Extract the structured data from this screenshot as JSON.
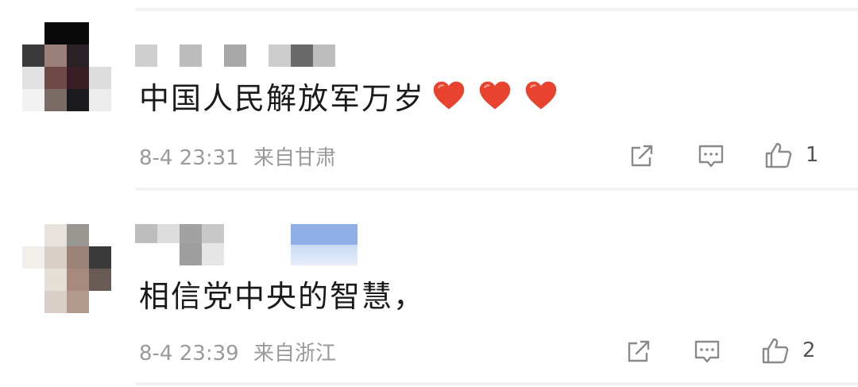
{
  "comments": [
    {
      "text": "中国人民解放军万岁",
      "hearts": [
        "heart-icon",
        "heart-icon",
        "heart-icon"
      ],
      "time": "8-4 23:31",
      "location": "来自甘肃",
      "likes": "1"
    },
    {
      "text": "相信党中央的智慧，",
      "time": "8-4 23:39",
      "location": "来自浙江",
      "likes": "2"
    }
  ],
  "colors": {
    "heart": "#e8432f",
    "meta_text": "#9a9a9a",
    "icon_stroke": "#8a8a8a"
  },
  "icons": {
    "repost": "repost-icon",
    "reply": "comment-icon",
    "like": "thumbs-up-icon"
  }
}
